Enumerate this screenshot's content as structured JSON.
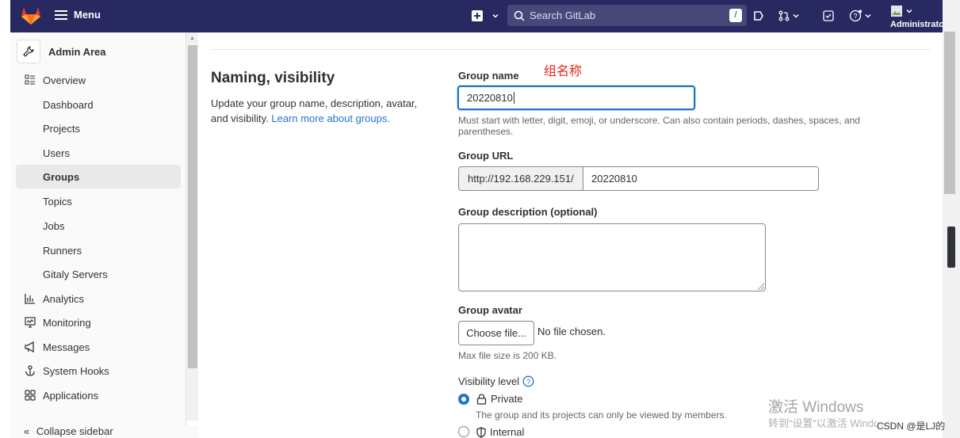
{
  "topbar": {
    "menu_label": "Menu",
    "search_placeholder": "Search GitLab",
    "search_shortcut": "/",
    "user_label": "Administrato"
  },
  "sidebar": {
    "title": "Admin Area",
    "items": [
      {
        "label": "Overview",
        "icon": "overview-icon"
      },
      {
        "label": "Dashboard"
      },
      {
        "label": "Projects"
      },
      {
        "label": "Users"
      },
      {
        "label": "Groups",
        "active": true
      },
      {
        "label": "Topics"
      },
      {
        "label": "Jobs"
      },
      {
        "label": "Runners"
      },
      {
        "label": "Gitaly Servers"
      },
      {
        "label": "Analytics",
        "icon": "analytics-icon"
      },
      {
        "label": "Monitoring",
        "icon": "monitoring-icon"
      },
      {
        "label": "Messages",
        "icon": "messages-icon"
      },
      {
        "label": "System Hooks",
        "icon": "hook-icon"
      },
      {
        "label": "Applications",
        "icon": "applications-icon"
      }
    ],
    "collapse_label": "Collapse sidebar"
  },
  "section": {
    "title": "Naming, visibility",
    "description": "Update your group name, description, avatar, and visibility.",
    "learn_more": "Learn more about groups."
  },
  "form": {
    "annotation": "组名称",
    "group_name_label": "Group name",
    "group_name_value": "20220810",
    "group_name_help": "Must start with letter, digit, emoji, or underscore. Can also contain periods, dashes, spaces, and parentheses.",
    "group_url_label": "Group URL",
    "group_url_prefix": "http://192.168.229.151/",
    "group_url_value": "20220810",
    "description_label": "Group description (optional)",
    "avatar_label": "Group avatar",
    "choose_file": "Choose file...",
    "no_file": "No file chosen.",
    "max_size": "Max file size is 200 KB.",
    "visibility_label": "Visibility level",
    "private_label": "Private",
    "private_help": "The group and its projects can only be viewed by members.",
    "internal_label": "Internal"
  },
  "overlay": {
    "watermark_title": "激活 Windows",
    "watermark_sub": "转到“设置”以激活 Windows。",
    "csdn": "CSDN @是LJ的"
  },
  "colors": {
    "topbar": "#292961",
    "accent": "#1f75cb",
    "annotation": "#e3261d"
  }
}
